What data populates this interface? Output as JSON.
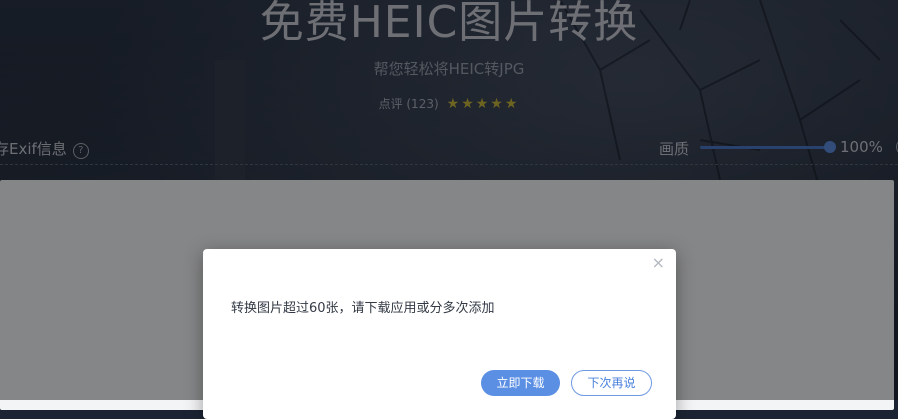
{
  "header": {
    "title": "免费HEIC图片转换",
    "subtitle": "帮您轻松将HEIC转JPG",
    "rating_label": "点评 (123)",
    "stars": "★★★★★",
    "rating_value": 5
  },
  "settings": {
    "exif_label": "存Exif信息",
    "help_glyph": "?",
    "quality_label": "画质",
    "quality_value": "100%",
    "quality_fraction": 1.0
  },
  "dialog": {
    "close_glyph": "×",
    "message": "转换图片超过60张，请下载应用或分多次添加",
    "primary_label": "立即下载",
    "secondary_label": "下次再说"
  },
  "colors": {
    "accent": "#5b8fe4",
    "star": "#c8b73c"
  }
}
